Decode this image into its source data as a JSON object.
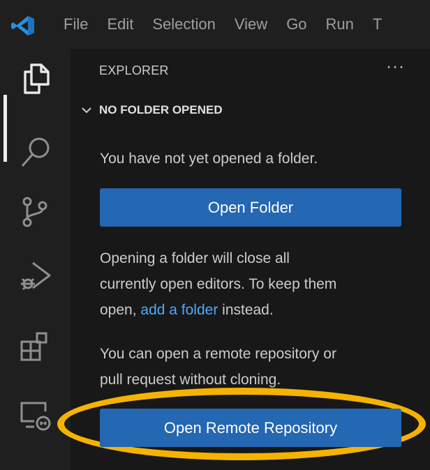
{
  "menu": [
    "File",
    "Edit",
    "Selection",
    "View",
    "Go",
    "Run",
    "T"
  ],
  "explorer": {
    "title": "EXPLORER",
    "more": "···",
    "section_title": "NO FOLDER OPENED",
    "message1": "You have not yet opened a folder.",
    "open_folder_button": "Open Folder",
    "message2_line1": "Opening a folder will close all",
    "message2_line2": "currently open editors. To keep them",
    "message2_line3_pre": "open, ",
    "message2_link": "add a folder",
    "message2_line3_post": " instead.",
    "message3_line1": "You can open a remote repository or",
    "message3_line2": "pull request without cloning.",
    "open_remote_button": "Open Remote Repository"
  },
  "activity_bar": [
    "files-icon",
    "search-icon",
    "source-control-icon",
    "run-debug-icon",
    "extensions-icon",
    "remote-explorer-icon"
  ],
  "colors": {
    "accent_button": "#2467b2",
    "link": "#4daafc",
    "highlight": "#f5b300"
  }
}
